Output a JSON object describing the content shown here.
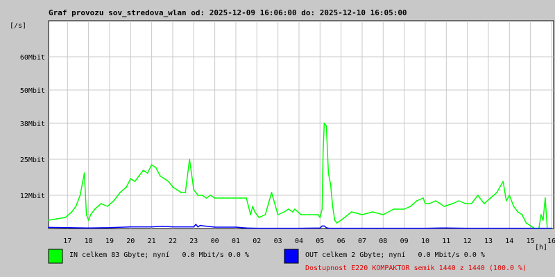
{
  "chart_data": {
    "type": "line",
    "title": "Graf provozu sov_stredova_wlan od: 2025-12-09 16:06:00 do: 2025-12-10 16:05:00",
    "y_unit_label": "[/s]",
    "x_unit_label": "[h]",
    "y_ticks": [
      "12Mbit",
      "25Mbit",
      "38Mbit",
      "50Mbit",
      "60Mbit"
    ],
    "y_tick_values": [
      12,
      25,
      38,
      50,
      62
    ],
    "ylim": [
      0,
      75
    ],
    "x_ticks": [
      "17",
      "18",
      "19",
      "20",
      "21",
      "22",
      "23",
      "00",
      "01",
      "02",
      "03",
      "04",
      "05",
      "06",
      "07",
      "08",
      "09",
      "10",
      "11",
      "12",
      "13",
      "14",
      "15",
      "16"
    ],
    "x_tick_hours": [
      17,
      18,
      19,
      20,
      21,
      22,
      23,
      24,
      25,
      26,
      27,
      28,
      29,
      30,
      31,
      32,
      33,
      34,
      35,
      36,
      37,
      38,
      39,
      40
    ],
    "xlim": [
      16.1,
      40.1
    ],
    "grid": true,
    "series": [
      {
        "name": "IN",
        "color": "#00ff00",
        "x": [
          16.1,
          16.5,
          16.9,
          17.2,
          17.4,
          17.6,
          17.8,
          17.9,
          18.0,
          18.1,
          18.3,
          18.6,
          18.9,
          19.2,
          19.5,
          19.8,
          20.0,
          20.2,
          20.4,
          20.6,
          20.8,
          21.0,
          21.2,
          21.4,
          21.6,
          21.8,
          22.0,
          22.2,
          22.4,
          22.6,
          22.8,
          23.0,
          23.2,
          23.4,
          23.6,
          23.8,
          24.0,
          24.3,
          24.6,
          24.9,
          25.2,
          25.5,
          25.7,
          25.8,
          25.9,
          26.1,
          26.4,
          26.7,
          27.0,
          27.3,
          27.5,
          27.7,
          27.8,
          28.1,
          28.5,
          28.9,
          29.0,
          29.1,
          29.15,
          29.2,
          29.3,
          29.4,
          29.5,
          29.6,
          29.7,
          29.8,
          30.0,
          30.5,
          31.0,
          31.5,
          32.0,
          32.5,
          33.0,
          33.3,
          33.6,
          33.9,
          34.0,
          34.2,
          34.5,
          34.9,
          35.3,
          35.6,
          35.9,
          36.2,
          36.5,
          36.8,
          37.1,
          37.4,
          37.7,
          37.85,
          38.0,
          38.2,
          38.4,
          38.6,
          38.8,
          39.0,
          39.2,
          39.4,
          39.5,
          39.6,
          39.7,
          39.8,
          40.0
        ],
        "values": [
          3,
          3.5,
          4,
          6,
          8,
          12,
          20,
          5,
          3,
          5,
          7,
          9,
          8,
          10,
          13,
          15,
          18,
          17,
          19,
          21,
          20,
          23,
          22,
          19,
          18,
          17,
          15,
          14,
          13,
          13,
          25,
          14,
          12,
          12,
          11,
          12,
          11,
          11,
          11,
          11,
          11,
          11,
          5,
          8,
          6,
          4,
          5,
          13,
          5,
          6,
          7,
          6,
          7,
          5,
          5,
          5,
          4,
          7,
          28,
          38,
          37,
          20,
          16,
          8,
          3,
          2,
          3,
          6,
          5,
          6,
          5,
          7,
          7,
          8,
          10,
          11,
          9,
          9,
          10,
          8,
          9,
          10,
          9,
          9,
          12,
          9,
          11,
          13,
          17,
          10,
          12,
          8,
          6,
          5,
          2,
          1,
          0,
          0,
          5,
          3,
          11,
          0,
          0
        ]
      },
      {
        "name": "OUT",
        "color": "#0000ff",
        "x": [
          16.1,
          17.0,
          18.0,
          19.0,
          20.0,
          21.0,
          21.5,
          22.0,
          23.0,
          23.1,
          23.2,
          23.3,
          24.0,
          25.0,
          25.5,
          26.0,
          27.0,
          28.0,
          29.0,
          29.1,
          29.2,
          29.3,
          29.4,
          30.0,
          31.0,
          32.0,
          33.0,
          34.0,
          35.0,
          36.0,
          37.0,
          38.0,
          39.0,
          40.0
        ],
        "values": [
          0.4,
          0.3,
          0.2,
          0.3,
          0.6,
          0.6,
          0.8,
          0.6,
          0.6,
          1.5,
          0.6,
          1.1,
          0.5,
          0.5,
          0.2,
          0.1,
          0.1,
          0.1,
          0.2,
          0.9,
          0.9,
          0.3,
          0.1,
          0.1,
          0.1,
          0.1,
          0.1,
          0.1,
          0.2,
          0.1,
          0.1,
          0.1,
          0.1,
          0.1
        ]
      }
    ]
  },
  "legend": {
    "in": {
      "color": "#00ff00",
      "text": "IN celkem 83 Gbyte; nyní   0.0 Mbit/s 0.0 %"
    },
    "out": {
      "color": "#0000ff",
      "text": "OUT celkem 2 Gbyte; nyní   0.0 Mbit/s 0.0 %"
    }
  },
  "availability": {
    "text": "Dostupnost E220 KOMPAKTOR semik 1440 z 1440 (100.0 %)",
    "color": "#e00000"
  }
}
